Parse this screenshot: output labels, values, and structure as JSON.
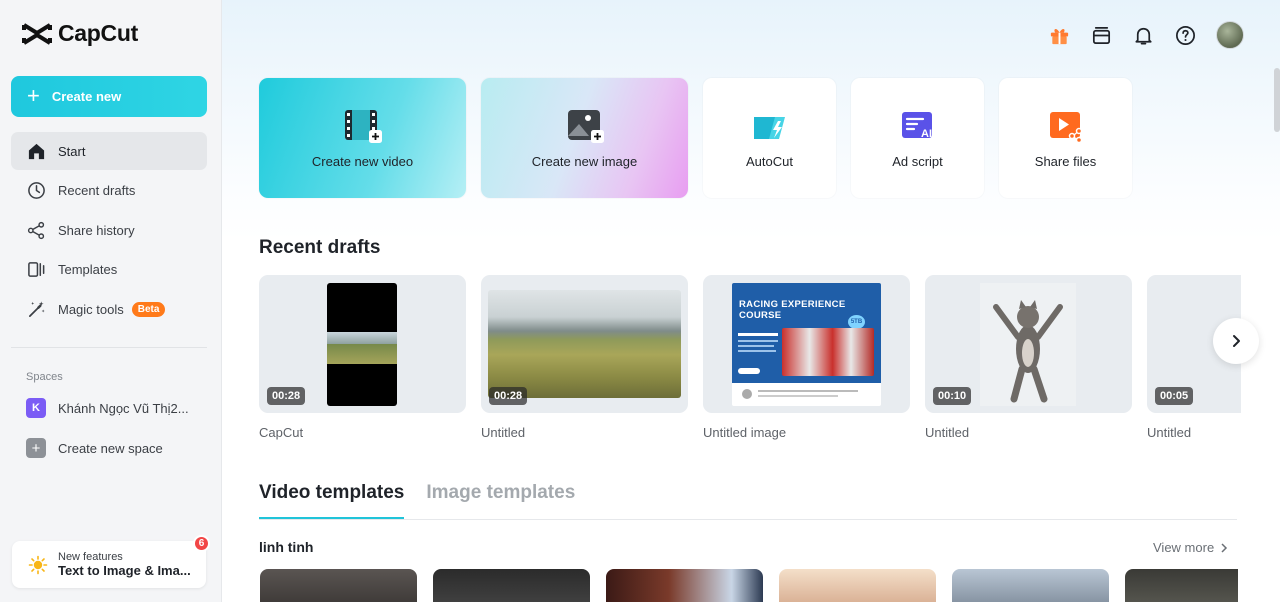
{
  "app": {
    "name": "CapCut",
    "create_label": "Create new"
  },
  "sidebar": {
    "items": [
      {
        "label": "Start",
        "icon": "home-icon"
      },
      {
        "label": "Recent drafts",
        "icon": "clock-icon"
      },
      {
        "label": "Share history",
        "icon": "share-icon"
      },
      {
        "label": "Templates",
        "icon": "templates-icon"
      },
      {
        "label": "Magic tools",
        "icon": "magic-wand-icon",
        "badge": "Beta"
      }
    ],
    "spaces_label": "Spaces",
    "space_name": "Khánh Ngọc Vũ Thị2...",
    "space_initial": "K",
    "create_space_label": "Create new space",
    "new_features": {
      "small": "New features",
      "big": "Text to Image & Ima...",
      "count": "6"
    }
  },
  "quick_actions": [
    {
      "label": "Create new video",
      "icon": "film-plus-icon"
    },
    {
      "label": "Create new image",
      "icon": "image-plus-icon"
    },
    {
      "label": "AutoCut",
      "icon": "autocut-icon"
    },
    {
      "label": "Ad script",
      "icon": "ad-script-icon"
    },
    {
      "label": "Share files",
      "icon": "share-files-icon"
    }
  ],
  "recent_drafts": {
    "title": "Recent drafts",
    "items": [
      {
        "name": "CapCut",
        "duration": "00:28"
      },
      {
        "name": "Untitled",
        "duration": "00:28"
      },
      {
        "name": "Untitled image",
        "duration": "",
        "poster_title": "RACING EXPERIENCE COURSE",
        "poster_badge": "5TB"
      },
      {
        "name": "Untitled",
        "duration": "00:10"
      },
      {
        "name": "Untitled",
        "duration": "00:05"
      }
    ]
  },
  "templates": {
    "tabs": [
      "Video templates",
      "Image templates"
    ],
    "row_title": "linh tinh",
    "view_more": "View more"
  },
  "colors": {
    "accent": "#20c4d9",
    "beta": "#ff7a1a",
    "notification": "#f24646"
  }
}
